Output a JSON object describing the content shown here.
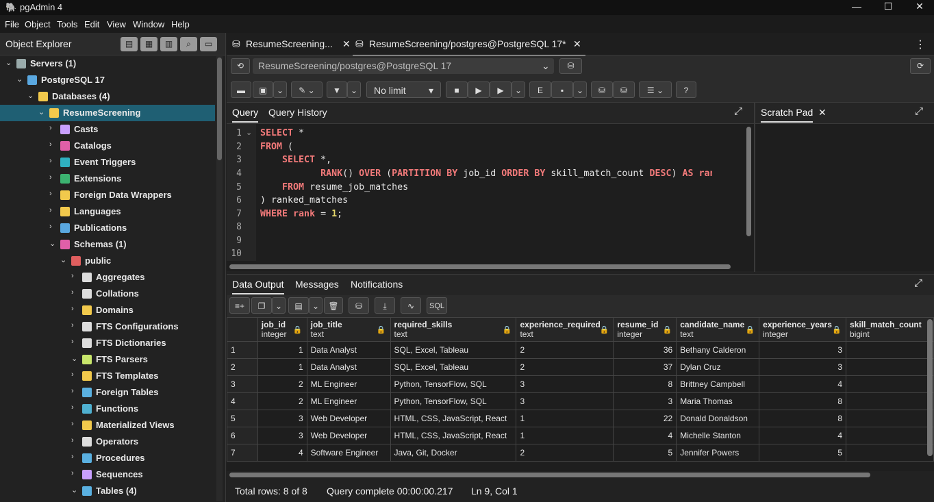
{
  "app": {
    "title": "pgAdmin 4"
  },
  "window_controls": {
    "minimize": "—",
    "maximize": "☐",
    "close": "✕"
  },
  "menu": [
    "File",
    "Object",
    "Tools",
    "Edit",
    "View",
    "Window",
    "Help"
  ],
  "object_explorer": {
    "title": "Object Explorer",
    "tree": [
      {
        "label": "Servers (1)",
        "level": 0,
        "expanded": true,
        "icon": "servers-icon"
      },
      {
        "label": "PostgreSQL 17",
        "level": 1,
        "expanded": true,
        "icon": "elephant-icon"
      },
      {
        "label": "Databases (4)",
        "level": 2,
        "expanded": true,
        "icon": "databases-icon"
      },
      {
        "label": "ResumeScreening",
        "level": 3,
        "expanded": true,
        "selected": true,
        "icon": "database-icon"
      },
      {
        "label": "Casts",
        "level": 4,
        "expanded": false,
        "icon": "casts-icon"
      },
      {
        "label": "Catalogs",
        "level": 4,
        "expanded": false,
        "icon": "catalogs-icon"
      },
      {
        "label": "Event Triggers",
        "level": 4,
        "expanded": false,
        "icon": "event-triggers-icon"
      },
      {
        "label": "Extensions",
        "level": 4,
        "expanded": false,
        "icon": "extensions-icon"
      },
      {
        "label": "Foreign Data Wrappers",
        "level": 4,
        "expanded": false,
        "icon": "fdw-icon"
      },
      {
        "label": "Languages",
        "level": 4,
        "expanded": false,
        "icon": "languages-icon"
      },
      {
        "label": "Publications",
        "level": 4,
        "expanded": false,
        "icon": "publications-icon"
      },
      {
        "label": "Schemas (1)",
        "level": 4,
        "expanded": true,
        "icon": "schemas-icon"
      },
      {
        "label": "public",
        "level": 5,
        "expanded": true,
        "icon": "schema-icon"
      },
      {
        "label": "Aggregates",
        "level": 6,
        "expanded": false,
        "icon": "aggregates-icon"
      },
      {
        "label": "Collations",
        "level": 6,
        "expanded": false,
        "icon": "collations-icon"
      },
      {
        "label": "Domains",
        "level": 6,
        "expanded": false,
        "icon": "domains-icon"
      },
      {
        "label": "FTS Configurations",
        "level": 6,
        "expanded": false,
        "icon": "fts-config-icon"
      },
      {
        "label": "FTS Dictionaries",
        "level": 6,
        "expanded": false,
        "icon": "fts-dict-icon"
      },
      {
        "label": "FTS Parsers",
        "level": 6,
        "expanded": true,
        "icon": "fts-parsers-icon"
      },
      {
        "label": "FTS Templates",
        "level": 6,
        "expanded": false,
        "icon": "fts-templates-icon"
      },
      {
        "label": "Foreign Tables",
        "level": 6,
        "expanded": false,
        "icon": "foreign-tables-icon"
      },
      {
        "label": "Functions",
        "level": 6,
        "expanded": false,
        "icon": "functions-icon"
      },
      {
        "label": "Materialized Views",
        "level": 6,
        "expanded": false,
        "icon": "mat-views-icon"
      },
      {
        "label": "Operators",
        "level": 6,
        "expanded": false,
        "icon": "operators-icon"
      },
      {
        "label": "Procedures",
        "level": 6,
        "expanded": false,
        "icon": "procedures-icon"
      },
      {
        "label": "Sequences",
        "level": 6,
        "expanded": false,
        "icon": "sequences-icon"
      },
      {
        "label": "Tables (4)",
        "level": 6,
        "expanded": true,
        "icon": "tables-icon"
      }
    ]
  },
  "tabs": [
    {
      "label": "ResumeScreening...",
      "active": false
    },
    {
      "label": "ResumeScreening/postgres@PostgreSQL 17*",
      "active": true
    }
  ],
  "connection": {
    "value": "ResumeScreening/postgres@PostgreSQL 17"
  },
  "toolbar": {
    "limit": "No limit"
  },
  "query_tabs": [
    "Query",
    "Query History"
  ],
  "scratch": {
    "title": "Scratch Pad"
  },
  "editor": {
    "line_numbers": [
      "1",
      "2",
      "3",
      "4",
      "5",
      "6",
      "7",
      "8",
      "9",
      "10"
    ]
  },
  "output_tabs": [
    "Data Output",
    "Messages",
    "Notifications"
  ],
  "grid": {
    "columns": [
      {
        "name": "job_id",
        "type": "integer",
        "align": "r"
      },
      {
        "name": "job_title",
        "type": "text",
        "align": "l"
      },
      {
        "name": "required_skills",
        "type": "text",
        "align": "l"
      },
      {
        "name": "experience_required",
        "type": "text",
        "align": "l"
      },
      {
        "name": "resume_id",
        "type": "integer",
        "align": "r"
      },
      {
        "name": "candidate_name",
        "type": "text",
        "align": "l"
      },
      {
        "name": "experience_years",
        "type": "integer",
        "align": "r"
      },
      {
        "name": "skill_match_count",
        "type": "bigint",
        "align": "r"
      }
    ],
    "rows": [
      {
        "n": "1",
        "cells": [
          "1",
          "Data Analyst",
          "SQL, Excel, Tableau",
          "2",
          "36",
          "Bethany Calderon",
          "3",
          ""
        ]
      },
      {
        "n": "2",
        "cells": [
          "1",
          "Data Analyst",
          "SQL, Excel, Tableau",
          "2",
          "37",
          "Dylan Cruz",
          "3",
          ""
        ]
      },
      {
        "n": "3",
        "cells": [
          "2",
          "ML Engineer",
          "Python, TensorFlow, SQL",
          "3",
          "8",
          "Brittney Campbell",
          "4",
          ""
        ]
      },
      {
        "n": "4",
        "cells": [
          "2",
          "ML Engineer",
          "Python, TensorFlow, SQL",
          "3",
          "3",
          "Maria Thomas",
          "8",
          ""
        ]
      },
      {
        "n": "5",
        "cells": [
          "3",
          "Web Developer",
          "HTML, CSS, JavaScript, React",
          "1",
          "22",
          "Donald Donaldson",
          "8",
          ""
        ]
      },
      {
        "n": "6",
        "cells": [
          "3",
          "Web Developer",
          "HTML, CSS, JavaScript, React",
          "1",
          "4",
          "Michelle Stanton",
          "4",
          ""
        ]
      },
      {
        "n": "7",
        "cells": [
          "4",
          "Software Engineer",
          "Java, Git, Docker",
          "2",
          "5",
          "Jennifer Powers",
          "5",
          ""
        ]
      }
    ]
  },
  "status": {
    "total_rows": "Total rows: 8 of 8",
    "query_complete": "Query complete 00:00:00.217",
    "cursor": "Ln 9, Col 1"
  },
  "icons": {
    "lock": "lock-icon",
    "close": "close-icon",
    "expand": "expand-icon",
    "kebab": "kebab-icon"
  }
}
